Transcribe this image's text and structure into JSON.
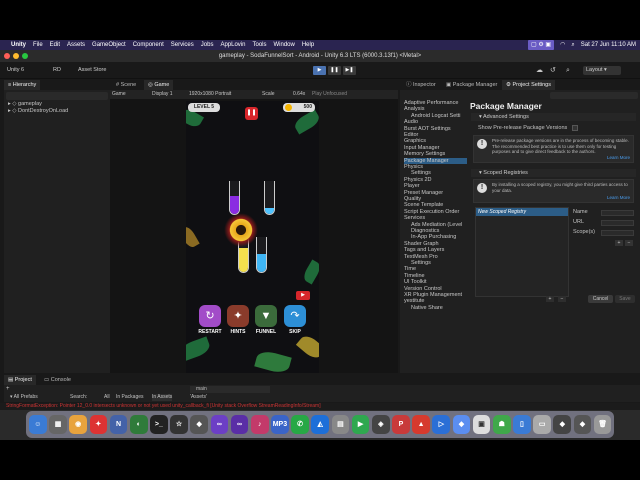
{
  "menubar": {
    "app": "Unity",
    "items": [
      "File",
      "Edit",
      "Assets",
      "GameObject",
      "Component",
      "Services",
      "Jobs",
      "AppLovin",
      "Tools",
      "Window",
      "Help"
    ],
    "clock": "Sat 27 Jun  11:10 AM"
  },
  "window_title": "gameplay - SodaFunnelSort - Android - Unity 6.3 LTS (6000.3.13f1) <Metal>",
  "toolbar": {
    "unity_label": "Unity 6",
    "account": "RD",
    "asset_store": "Asset Store",
    "layout": "Layout"
  },
  "hierarchy": {
    "tab": "Hierarchy",
    "items": [
      "gameplay",
      "DontDestroyOnLoad"
    ]
  },
  "scene_tabs": [
    "Scene",
    "Game"
  ],
  "game_toolbar": {
    "mode": "Game",
    "display": "Display 1",
    "resolution": "1920x1080 Portrait",
    "scale_label": "Scale",
    "scale_value": "0.64x",
    "play_focused": "Play Unfocused"
  },
  "game": {
    "level": "LEVEL 5",
    "coins": "500",
    "buttons": [
      {
        "label": "RESTART",
        "icon": "restart-icon",
        "color": "#a24cc8"
      },
      {
        "label": "HINTS",
        "icon": "hints-icon",
        "color": "#8a3b2b"
      },
      {
        "label": "FUNNEL",
        "icon": "funnel-icon",
        "color": "#3b6b3b"
      },
      {
        "label": "SKIP",
        "icon": "skip-icon",
        "color": "#2d8fd6"
      }
    ]
  },
  "inspector_tabs": [
    "Inspector",
    "Package Manager",
    "Project Settings"
  ],
  "settings_list": [
    "Adaptive Performance",
    "Analysis",
    "Android Logcat Setti",
    "Audio",
    "Burst AOT Settings",
    "Editor",
    "Graphics",
    "Input Manager",
    "Memory Settings",
    "Package Manager",
    "Physics",
    "Settings",
    "Physics 2D",
    "Player",
    "Preset Manager",
    "Quality",
    "Scene Template",
    "Script Execution Order",
    "Services",
    "Ads Mediation (Level",
    "Diagnostics",
    "In-App Purchasing",
    "Shader Graph",
    "Tags and Layers",
    "TextMesh Pro",
    "Settings",
    "Time",
    "Timeline",
    "UI Toolkit",
    "Version Control",
    "XR Plugin Management",
    "yestitute",
    "Native Share"
  ],
  "package_manager": {
    "title": "Package Manager",
    "advanced_settings": "Advanced Settings",
    "show_prerelease": "Show Pre-release Package Versions",
    "prerelease_info": "Pre-release package versions are in the process of becoming stable. The recommended best practice is to use them only for testing purposes and to give direct feedback to the authors.",
    "learn_more": "Learn More",
    "scoped_registries": "Scoped Registries",
    "scoped_info": "By installing a scoped registry, you might give third parties access to your data.",
    "new_registry": "New Scoped Registry",
    "fields": [
      "Name",
      "URL",
      "Scope(s)"
    ],
    "cancel": "Cancel",
    "save": "Save"
  },
  "bottom": {
    "tabs": [
      "Project",
      "Console"
    ],
    "favorites": "Favorites",
    "all_prefabs": "All Prefabs",
    "search_label": "Search:",
    "search_all": "All",
    "search_packages": "In Packages",
    "search_assets": "In Assets",
    "search_assets_quoted": "'Assets'",
    "asset_item": "main",
    "add_label": "+"
  },
  "status_error": "StringFormatException: Pointer 12_0.0 intersects unknown or not yet used unity_callback_fi [Unity stack Overflow StreamReadingInfo/Stream]"
}
